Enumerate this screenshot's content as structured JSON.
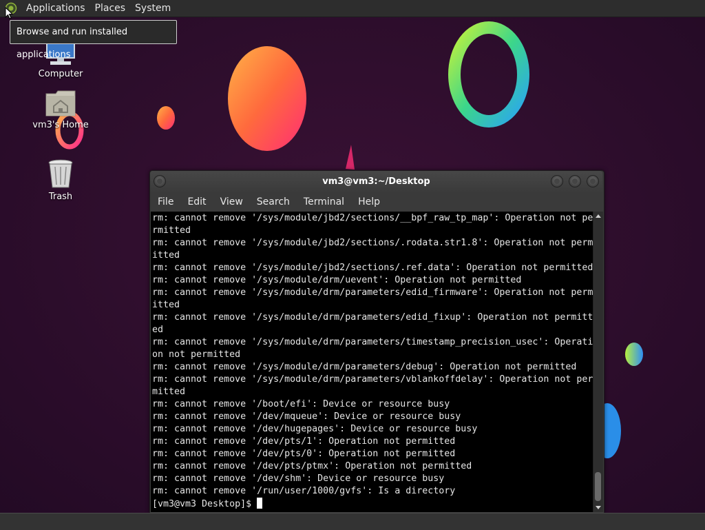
{
  "top_panel": {
    "menus": [
      "Applications",
      "Places",
      "System"
    ],
    "tooltip": "Browse and run installed applications"
  },
  "desktop_icons": [
    {
      "label": "Computer",
      "icon": "computer-icon"
    },
    {
      "label": "vm3's Home",
      "icon": "home-folder-icon"
    },
    {
      "label": "Trash",
      "icon": "trash-icon"
    }
  ],
  "terminal": {
    "title": "vm3@vm3:~/Desktop",
    "menu": [
      "File",
      "Edit",
      "View",
      "Search",
      "Terminal",
      "Help"
    ],
    "lines": [
      "rm: cannot remove '/sys/module/jbd2/sections/__bpf_raw_tp_map': Operation not pe",
      "rmitted",
      "rm: cannot remove '/sys/module/jbd2/sections/.rodata.str1.8': Operation not perm",
      "itted",
      "rm: cannot remove '/sys/module/jbd2/sections/.ref.data': Operation not permitted",
      "rm: cannot remove '/sys/module/drm/uevent': Operation not permitted",
      "rm: cannot remove '/sys/module/drm/parameters/edid_firmware': Operation not perm",
      "itted",
      "rm: cannot remove '/sys/module/drm/parameters/edid_fixup': Operation not permitt",
      "ed",
      "rm: cannot remove '/sys/module/drm/parameters/timestamp_precision_usec': Operati",
      "on not permitted",
      "rm: cannot remove '/sys/module/drm/parameters/debug': Operation not permitted",
      "rm: cannot remove '/sys/module/drm/parameters/vblankoffdelay': Operation not per",
      "mitted",
      "rm: cannot remove '/boot/efi': Device or resource busy",
      "rm: cannot remove '/dev/mqueue': Device or resource busy",
      "rm: cannot remove '/dev/hugepages': Device or resource busy",
      "rm: cannot remove '/dev/pts/1': Operation not permitted",
      "rm: cannot remove '/dev/pts/0': Operation not permitted",
      "rm: cannot remove '/dev/pts/ptmx': Operation not permitted",
      "rm: cannot remove '/dev/shm': Device or resource busy",
      "rm: cannot remove '/run/user/1000/gvfs': Is a directory"
    ],
    "prompt": "[vm3@vm3 Desktop]$ "
  }
}
